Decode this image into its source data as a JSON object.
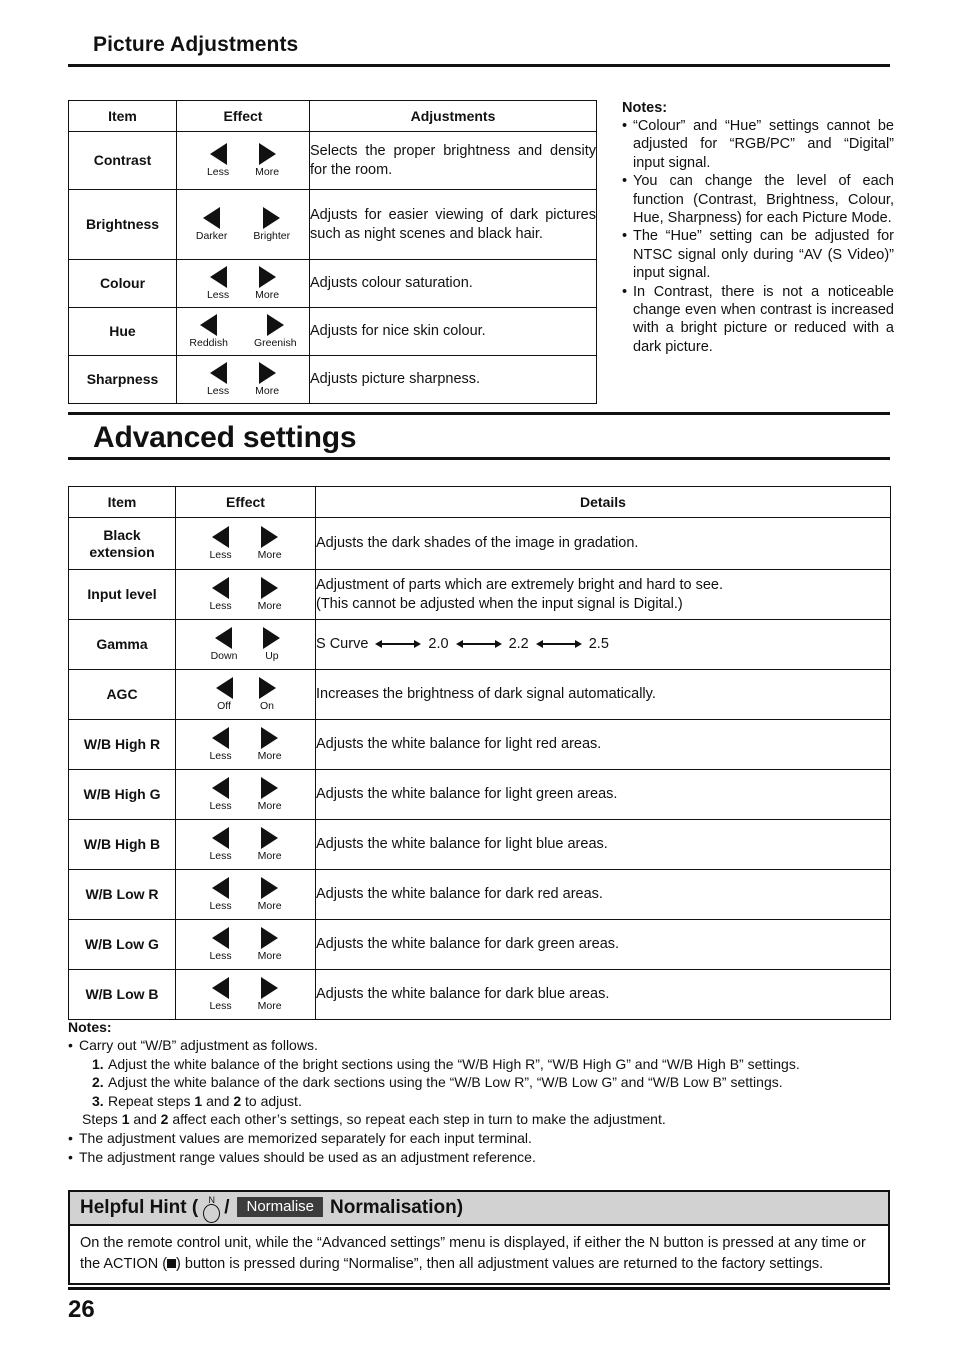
{
  "document": {
    "page_number": "26"
  },
  "section1": {
    "title": "Picture Adjustments",
    "table": {
      "headers": [
        "Item",
        "Effect",
        "Adjustments"
      ],
      "rows": [
        {
          "item": "Contrast",
          "left_label": "Less",
          "right_label": "More",
          "detail": "Selects the proper brightness and density for the room."
        },
        {
          "item": "Brightness",
          "left_label": "Darker",
          "right_label": "Brighter",
          "detail": "Adjusts for easier viewing of dark pictures such as night scenes and black hair."
        },
        {
          "item": "Colour",
          "left_label": "Less",
          "right_label": "More",
          "detail": "Adjusts colour saturation."
        },
        {
          "item": "Hue",
          "left_label": "Reddish",
          "right_label": "Greenish",
          "detail": "Adjusts for nice skin colour."
        },
        {
          "item": "Sharpness",
          "left_label": "Less",
          "right_label": "More",
          "detail": "Adjusts picture sharpness."
        }
      ]
    },
    "notes": {
      "title": "Notes:",
      "bullet": "•",
      "items": [
        "“Colour” and “Hue” settings cannot be adjusted for “RGB/PC” and “Digital” input signal.",
        "You can change the level of each function (Contrast, Brightness, Colour, Hue, Sharpness) for each Picture Mode.",
        "The “Hue” setting can be adjusted for NTSC signal only during “AV (S Video)” input signal.",
        "In Contrast, there is not a noticeable change even when contrast is increased with a bright picture or reduced with a dark picture."
      ]
    }
  },
  "section2": {
    "title": "Advanced settings",
    "table": {
      "headers": [
        "Item",
        "Effect",
        "Details"
      ],
      "rows": [
        {
          "item": "Black extension",
          "left_label": "Less",
          "right_label": "More",
          "detail": "Adjusts the dark shades of the image in gradation."
        },
        {
          "item": "Input level",
          "left_label": "Less",
          "right_label": "More",
          "detail": "Adjustment of parts which are extremely bright and hard to see.\n(This cannot be adjusted when the input signal is Digital.)"
        },
        {
          "item": "Gamma",
          "left_label": "Down",
          "right_label": "Up",
          "detail": "",
          "detail_type": "gamma-scale",
          "gamma_values": [
            "S Curve",
            "2.0",
            "2.2",
            "2.5"
          ]
        },
        {
          "item": "AGC",
          "left_label": "Off",
          "right_label": "On",
          "detail": "Increases the brightness of dark signal automatically."
        },
        {
          "item": "W/B High R",
          "left_label": "Less",
          "right_label": "More",
          "detail": "Adjusts the white balance for light red areas."
        },
        {
          "item": "W/B High G",
          "left_label": "Less",
          "right_label": "More",
          "detail": "Adjusts the white balance for light green areas."
        },
        {
          "item": "W/B High B",
          "left_label": "Less",
          "right_label": "More",
          "detail": "Adjusts the white balance for light blue areas."
        },
        {
          "item": "W/B Low R",
          "left_label": "Less",
          "right_label": "More",
          "detail": "Adjusts the white balance for dark red areas."
        },
        {
          "item": "W/B Low G",
          "left_label": "Less",
          "right_label": "More",
          "detail": "Adjusts the white balance for dark green areas."
        },
        {
          "item": "W/B Low B",
          "left_label": "Less",
          "right_label": "More",
          "detail": "Adjusts the white balance for dark blue areas."
        }
      ]
    },
    "notes": {
      "title": "Notes:",
      "bullet": "•",
      "lead": "Carry out “W/B” adjustment as follows.",
      "steps": [
        {
          "num": "1.",
          "text": "Adjust the white balance of the bright sections using the “W/B High R”, “W/B High G” and “W/B High B” settings."
        },
        {
          "num": "2.",
          "text": "Adjust the white balance of the dark sections using the “W/B Low R”, “W/B Low G” and “W/B Low B” settings."
        },
        {
          "num": "3.",
          "text": "Repeat steps 1 and 2 to adjust."
        }
      ],
      "steps_note": "Steps 1 and 2 affect each other’s settings, so repeat each step in turn to make the adjustment.",
      "items": [
        "The adjustment values are memorized separately for each input terminal.",
        "The adjustment range values should be used as an adjustment reference."
      ]
    }
  },
  "hint": {
    "prefix": "Helpful Hint (",
    "n_letter": "N",
    "separator": "/",
    "badge": "Normalise",
    "suffix": "Normalisation)",
    "body_part1": "On the remote control unit, while the “Advanced settings” menu is displayed, if either the N button is pressed at any time or the ACTION (",
    "body_part2": ") button is pressed during “Normalise”, then all adjustment values are returned to the factory settings.",
    "header_bg": "#d2d2d2",
    "badge_bg": "#3c3c3c"
  }
}
